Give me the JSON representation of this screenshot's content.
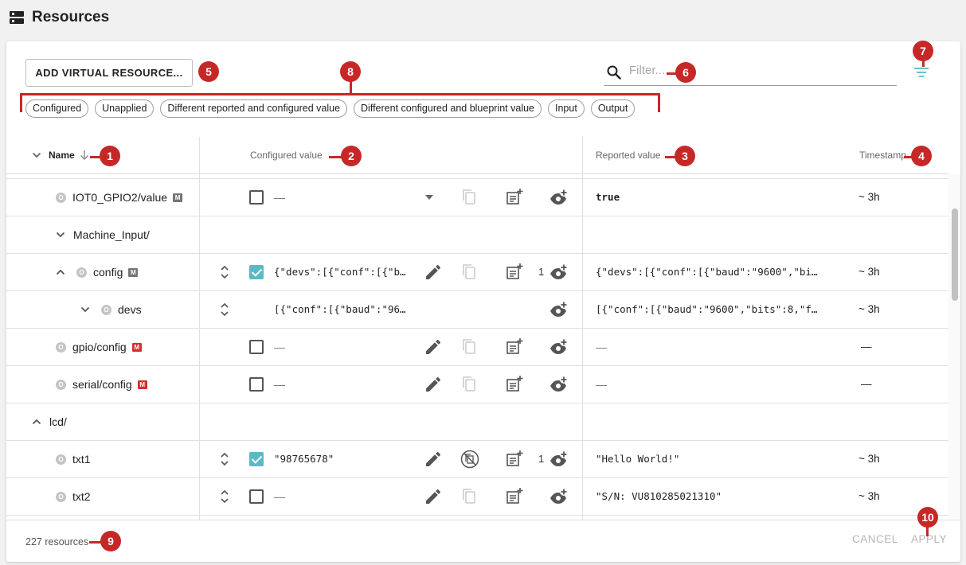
{
  "header": {
    "title": "Resources",
    "icon": "server-icon"
  },
  "toolbar": {
    "add_button": "ADD VIRTUAL RESOURCE...",
    "filter_placeholder": "Filter...",
    "chips": [
      "Configured",
      "Unapplied",
      "Different reported and configured value",
      "Different configured and blueprint value",
      "Input",
      "Output"
    ]
  },
  "table": {
    "headers": {
      "name": "Name",
      "configured": "Configured value",
      "reported": "Reported value",
      "timestamp": "Timestamp"
    },
    "rows": [
      {
        "name": "IOT0_GPIO2/value",
        "kind": "resource",
        "badge": "M",
        "badge_color": "#757575",
        "configured": "—",
        "reported": "true",
        "timestamp": "~ 3h"
      },
      {
        "name": "Machine_Input/",
        "kind": "folder"
      },
      {
        "name": "config",
        "kind": "resource",
        "badge": "M",
        "badge_color": "#757575",
        "configured": "{\"devs\":[{\"conf\":[{\"b…",
        "watch_count": "1",
        "reported": "{\"devs\":[{\"conf\":[{\"baud\":\"9600\",\"bi…",
        "timestamp": "~ 3h"
      },
      {
        "name": "devs",
        "kind": "resource",
        "configured": "[{\"conf\":[{\"baud\":\"96…",
        "reported": "[{\"conf\":[{\"baud\":\"9600\",\"bits\":8,\"f…",
        "timestamp": "~ 3h"
      },
      {
        "name": "gpio/config",
        "kind": "resource",
        "badge": "M",
        "badge_color": "#d32f2f",
        "configured": "—",
        "reported": "—",
        "timestamp": "—"
      },
      {
        "name": "serial/config",
        "kind": "resource",
        "badge": "M",
        "badge_color": "#d32f2f",
        "configured": "—",
        "reported": "—",
        "timestamp": "—"
      },
      {
        "name": "lcd/",
        "kind": "folder"
      },
      {
        "name": "txt1",
        "kind": "resource",
        "configured": "\"98765678\"",
        "watch_count": "1",
        "reported": "\"Hello World!\"",
        "timestamp": "~ 3h"
      },
      {
        "name": "txt2",
        "kind": "resource",
        "configured": "—",
        "reported": "\"S/N: VU810285021310\"",
        "timestamp": "~ 3h"
      }
    ]
  },
  "footer": {
    "count": "227 resources",
    "cancel": "CANCEL",
    "apply": "APPLY"
  },
  "callouts": [
    "1",
    "2",
    "3",
    "4",
    "5",
    "6",
    "7",
    "8",
    "9",
    "10"
  ],
  "colors": {
    "accent": "#5cb8c4",
    "callout": "#c62828"
  }
}
